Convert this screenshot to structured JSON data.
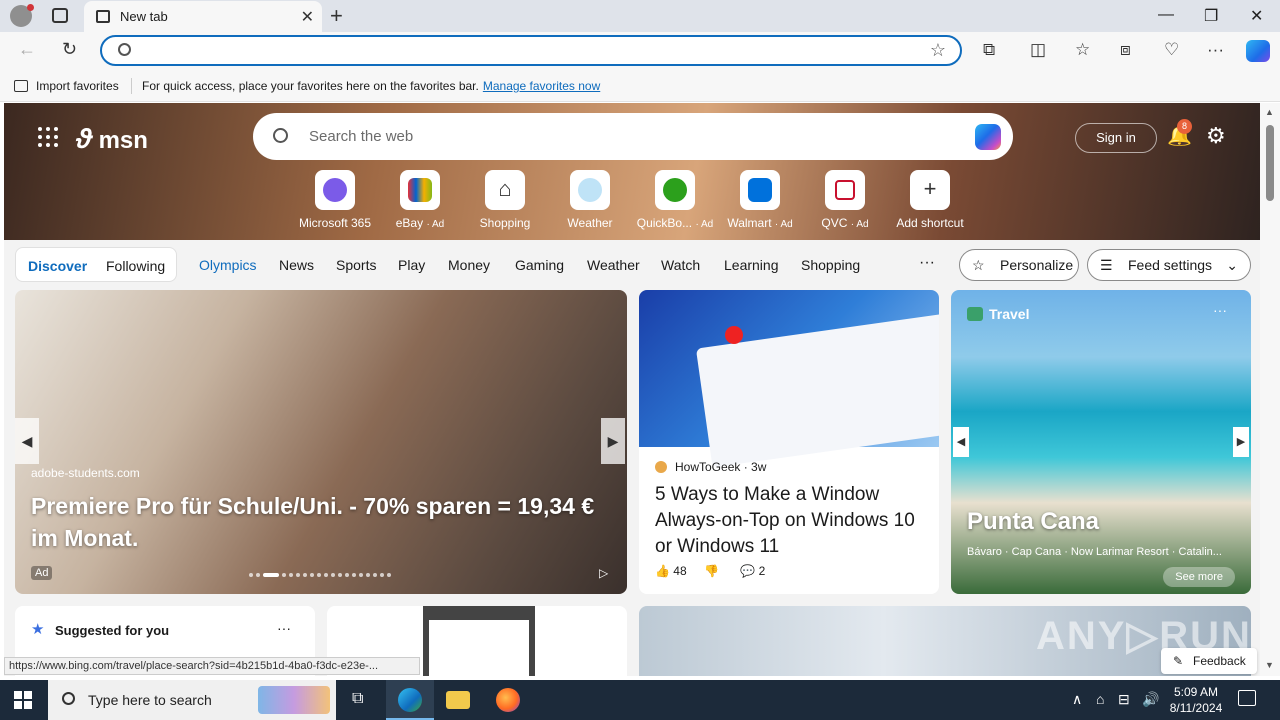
{
  "browser": {
    "tab_title": "New tab",
    "favorites_bar": {
      "import_label": "Import favorites",
      "message": "For quick access, place your favorites here on the favorites bar.",
      "manage_link": "Manage favorites now"
    },
    "status_url": "https://www.bing.com/travel/place-search?sid=4b215b1d-4ba0-f3dc-e23e-..."
  },
  "msn": {
    "logo": "msn",
    "search_placeholder": "Search the web",
    "signin": "Sign in",
    "notification_count": "8",
    "shortcuts": [
      {
        "label": "Microsoft 365",
        "ad": "",
        "icon": "microsoft-365-icon",
        "color": "#7b5be8"
      },
      {
        "label": "eBay",
        "ad": "· Ad",
        "icon": "ebay-icon",
        "color": "#e53238"
      },
      {
        "label": "Shopping",
        "ad": "",
        "icon": "shopping-tag-icon",
        "color": "#ffffff"
      },
      {
        "label": "Weather",
        "ad": "",
        "icon": "weather-icon",
        "color": "#bfe3f7"
      },
      {
        "label": "QuickBo...",
        "ad": "· Ad",
        "icon": "quickbooks-icon",
        "color": "#2ca01c"
      },
      {
        "label": "Walmart",
        "ad": "· Ad",
        "icon": "walmart-icon",
        "color": "#0071dc"
      },
      {
        "label": "QVC",
        "ad": "· Ad",
        "icon": "qvc-icon",
        "color": "#ffffff"
      },
      {
        "label": "Add shortcut",
        "ad": "",
        "icon": "plus-icon",
        "color": "#ffffff"
      }
    ],
    "feed_tabs": {
      "discover": "Discover",
      "following": "Following",
      "items": [
        "Olympics",
        "News",
        "Sports",
        "Play",
        "Money",
        "Gaming",
        "Weather",
        "Watch",
        "Learning",
        "Shopping"
      ],
      "more": "···",
      "personalize": "Personalize",
      "feed_settings": "Feed settings"
    },
    "hero_card": {
      "source": "adobe-students.com",
      "title": "Premiere Pro für Schule/Uni. - 70% sparen = 19,34 € im Monat.",
      "ad_label": "Ad"
    },
    "article_card": {
      "source": "HowToGeek",
      "age": "· 3w",
      "title": "5 Ways to Make a Window Always-on-Top on Windows 10 or Windows 11",
      "likes": "48",
      "comments": "2"
    },
    "travel_card": {
      "label": "Travel",
      "title": "Punta Cana",
      "subtitle": "Bávaro · Cap Cana · Now Larimar Resort · Catalin...",
      "see_more": "See more"
    },
    "suggested": {
      "title": "Suggested for you"
    },
    "feedback": "Feedback"
  },
  "taskbar": {
    "search_placeholder": "Type here to search",
    "time": "5:09 AM",
    "date": "8/11/2024"
  }
}
